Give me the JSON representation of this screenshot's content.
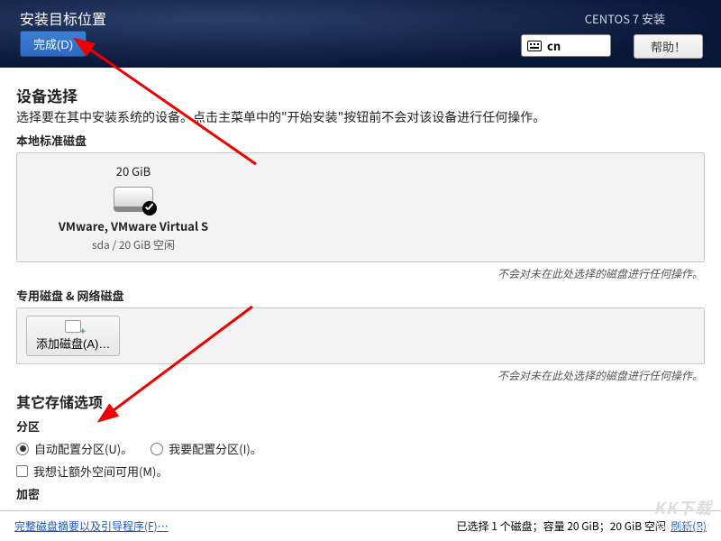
{
  "header": {
    "title": "安装目标位置",
    "subtitle": "CENTOS 7 安装",
    "done_btn": "完成(D)",
    "lang": "cn",
    "help_btn": "帮助！"
  },
  "device": {
    "heading": "设备选择",
    "desc": "选择要在其中安装系统的设备。点击主菜单中的\"开始安装\"按钮前不会对该设备进行任何操作。",
    "local_heading": "本地标准磁盘",
    "disk": {
      "capacity": "20 GiB",
      "name": "VMware, VMware Virtual S",
      "sub": "sda    /    20 GiB 空闲"
    },
    "note": "不会对未在此处选择的磁盘进行任何操作。",
    "special_heading": "专用磁盘 & 网络磁盘",
    "add_disk_btn": "添加磁盘(A)…",
    "note2": "不会对未在此处选择的磁盘进行任何操作。"
  },
  "storage": {
    "heading": "其它存储选项",
    "partition_heading": "分区",
    "auto_radio": "自动配置分区(U)。",
    "manual_radio": "我要配置分区(I)。",
    "extra_space": "我想让额外空间可用(M)。",
    "encrypt_heading": "加密"
  },
  "footer": {
    "summary_link": "完整磁盘摘要以及引导程序(F)…",
    "status": "已选择 1 个磁盘；容量 20 GiB；20 GiB 空闲",
    "refresh_link": "刷新(R)"
  },
  "watermark": {
    "main": "KK下载",
    "sub": "www.kkx.net"
  }
}
